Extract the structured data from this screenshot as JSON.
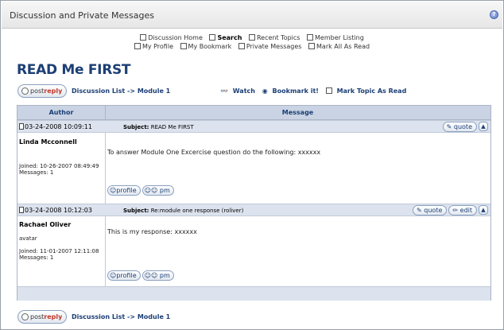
{
  "window": {
    "title": "Discussion and Private Messages"
  },
  "nav": {
    "row1": [
      {
        "label": "Discussion Home",
        "bold": false
      },
      {
        "label": "Search",
        "bold": true
      },
      {
        "label": "Recent Topics",
        "bold": false
      },
      {
        "label": "Member Listing",
        "bold": false
      }
    ],
    "row2": [
      {
        "label": "My Profile"
      },
      {
        "label": "My Bookmark"
      },
      {
        "label": "Private Messages"
      },
      {
        "label": "Mark All As Read"
      }
    ]
  },
  "page_title": "READ Me FIRST",
  "toolbar": {
    "postreply_post": "post",
    "postreply_reply": "reply",
    "breadcrumb": "Discussion List -> Module 1",
    "watch": "Watch",
    "bookmark": "Bookmark it!",
    "mark_read": "Mark Topic As Read"
  },
  "table": {
    "col_author": "Author",
    "col_message": "Message"
  },
  "posts": [
    {
      "date": "03-24-2008 10:09:11",
      "subject_label": "Subject:",
      "subject": "READ Me FIRST",
      "author": "Linda Mcconnell",
      "joined_label": "Joined:",
      "joined": "10-26-2007 08:49:49",
      "messages_label": "Messages:",
      "messages": "1",
      "body": "To answer Module One Excercise question do the following: xxxxxx",
      "buttons": {
        "quote": "quote",
        "profile": "profile",
        "pm": "pm"
      }
    },
    {
      "date": "03-24-2008 10:12:03",
      "subject_label": "Subject:",
      "subject": "Re:module one response (roliver)",
      "author": "Rachael Oliver",
      "avatar_text": "avatar",
      "joined_label": "Joined:",
      "joined": "11-01-2007 12:11:08",
      "messages_label": "Messages:",
      "messages": "1",
      "body": "This is my response: xxxxxx",
      "buttons": {
        "quote": "quote",
        "edit": "edit",
        "profile": "profile",
        "pm": "pm"
      }
    }
  ],
  "bottom": {
    "postreply_post": "post",
    "postreply_reply": "reply",
    "breadcrumb": "Discussion List -> Module 1"
  }
}
